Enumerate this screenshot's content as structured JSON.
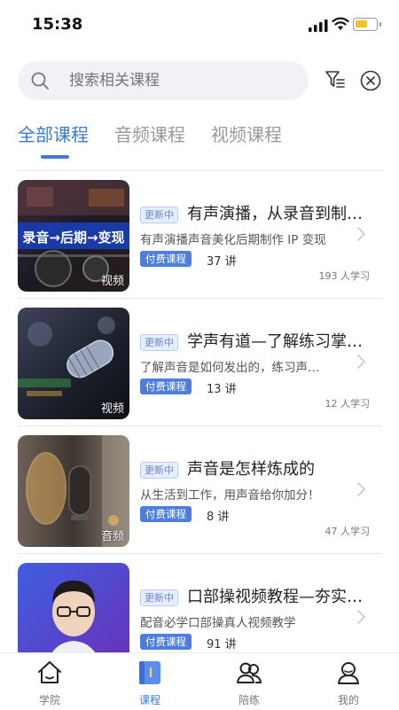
{
  "status_bar": {
    "time": "15:38"
  },
  "search": {
    "placeholder": "搜索相关课程"
  },
  "tabs": [
    {
      "label": "全部课程",
      "active": true
    },
    {
      "label": "音频课程",
      "active": false
    },
    {
      "label": "视频课程",
      "active": false
    }
  ],
  "courses": [
    {
      "badge": "更新中",
      "title": "有声演播，从录音到制…",
      "desc": "有声演播声音美化后期制作 IP 变现",
      "tag": "付费课程",
      "lessons": "37 讲",
      "learners": "193 人学习",
      "type": "视频",
      "thumb_text": "录音→后期→变现"
    },
    {
      "badge": "更新中",
      "title": "学声有道—了解练习掌…",
      "desc": "了解声音是如何发出的，练习声…",
      "tag": "付费课程",
      "lessons": "13 讲",
      "learners": "12 人学习",
      "type": "视频"
    },
    {
      "badge": "更新中",
      "title": "声音是怎样炼成的",
      "desc": "从生活到工作，用声音给你加分！",
      "tag": "付费课程",
      "lessons": "8 讲",
      "learners": "47 人学习",
      "type": "音频"
    },
    {
      "badge": "更新中",
      "title": "口部操视频教程—夯实…",
      "desc": "配音必学口部操真人视频教学",
      "tag": "付费课程",
      "lessons": "91 讲"
    }
  ],
  "bottom_nav": [
    {
      "label": "学院",
      "icon": "house-icon",
      "active": false
    },
    {
      "label": "课程",
      "icon": "book-icon",
      "active": true
    },
    {
      "label": "陪练",
      "icon": "people-icon",
      "active": false
    },
    {
      "label": "我的",
      "icon": "profile-icon",
      "active": false
    }
  ],
  "colors": {
    "accent": "#3a7bd5",
    "paid_badge": "#4e7de0",
    "battery": "#f2c21b"
  }
}
